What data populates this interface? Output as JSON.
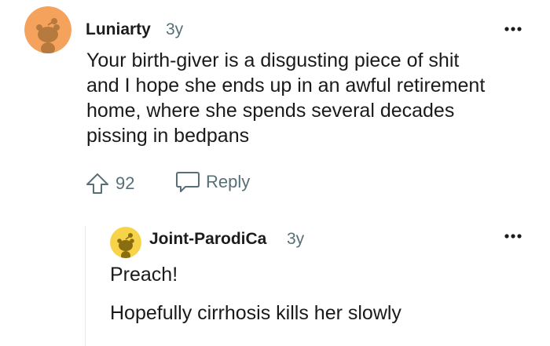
{
  "comment": {
    "author": "Luniarty",
    "age": "3y",
    "lines": [
      "Your birth-giver is a disgusting piece of shit",
      "and I hope she ends up in an awful retirement",
      "home, where she spends several decades",
      "pissing in bedpans"
    ],
    "upvote_count": "92",
    "reply_label": "Reply",
    "avatar_color": "#f5a25d"
  },
  "reply": {
    "author": "Joint-ParodiCa",
    "age": "3y",
    "paragraphs": [
      "Preach!",
      "Hopefully cirrhosis kills her slowly"
    ],
    "avatar_color": "#f7d34a"
  },
  "colors": {
    "text": "#1a1a1b",
    "meta": "#576f76",
    "thread_line": "#e4e6e7"
  }
}
